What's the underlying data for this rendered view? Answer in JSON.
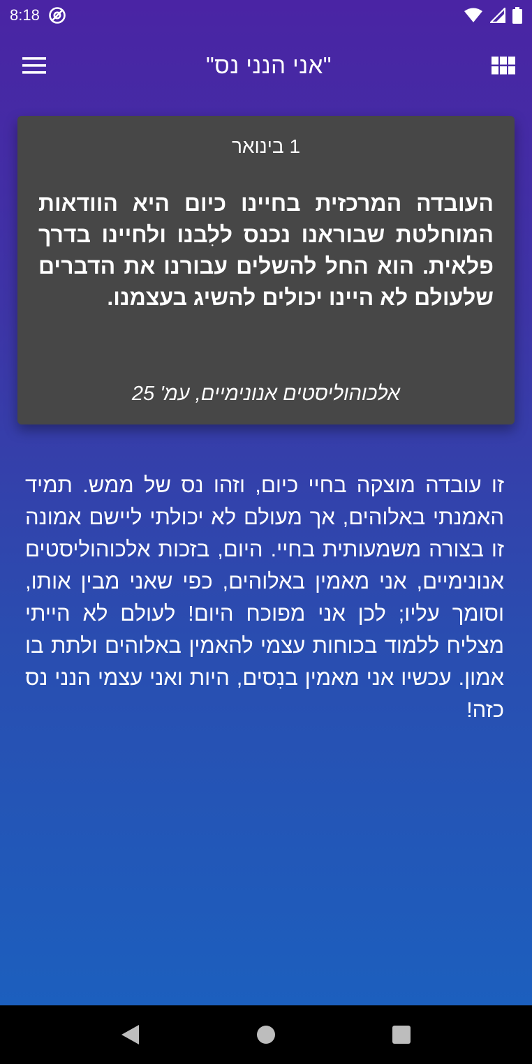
{
  "status_bar": {
    "time": "8:18",
    "icons": [
      "at-sign-icon",
      "wifi-icon",
      "signal-icon",
      "battery-icon"
    ]
  },
  "app_bar": {
    "title": "\"אני הנני נס\"",
    "menu_icon": "hamburger-menu-icon",
    "grid_icon": "grid-view-icon"
  },
  "card": {
    "date": "1 בינואר",
    "quote": "העובדה המרכזית בחיינו כיום היא הוודאות המוחלטת שבוראנו נכנס ללִבנו ולחיינו בדרך פלאית. הוא החל להשלים עבורנו את הדברים שלעולם לא היינו יכולים להשיג בעצמנו.",
    "source": "אלכוהוליסטים אנונימיים, עמ' 25"
  },
  "reflection": {
    "text": "זו עובדה מוצקה בחיי כיום, וזהו נס של ממש. תמיד האמנתי באלוהים, אך מעולם לא יכולתי ליישם אמונה זו בצורה משמעותית בחיי. היום, בזכות אלכוהוליסטים אנונימיים, אני מאמין באלוהים, כפי שאני מבין אותו, וסומך עליו; לכן אני מפוכח היום! לעולם לא הייתי מצליח ללמוד בכוחות עצמי להאמין באלוהים ולתת בו אמון. עכשיו אני מאמין בנִסים, היות ואני עצמי הנני נס כזה!"
  },
  "nav_bar": {
    "icons": [
      "back-triangle-icon",
      "home-circle-icon",
      "recents-square-icon"
    ]
  },
  "colors": {
    "gradient_top": "#4a24a4",
    "gradient_bottom": "#1a62c0",
    "card_bg": "#474747",
    "text": "#ffffff"
  }
}
